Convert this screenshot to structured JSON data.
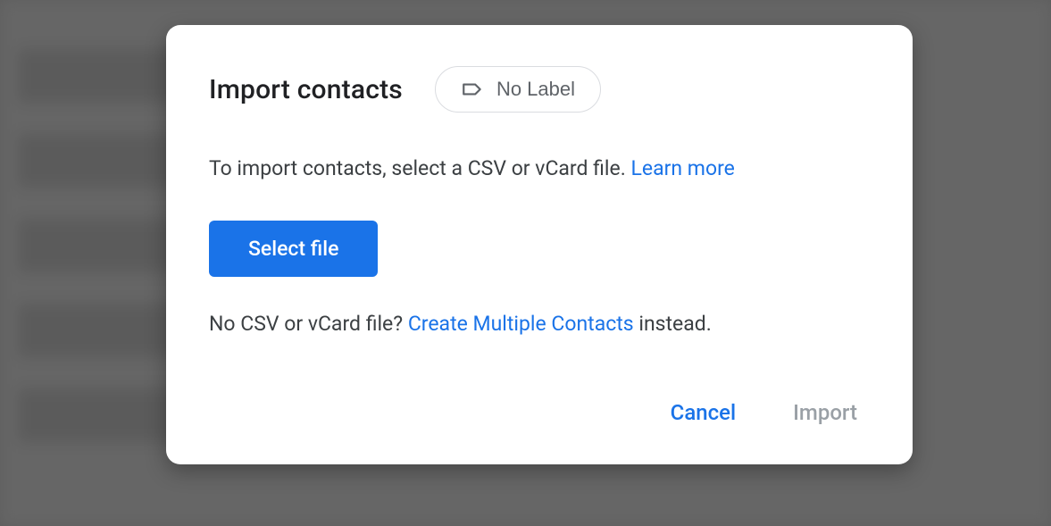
{
  "dialog": {
    "title": "Import contacts",
    "labelChip": {
      "text": "No Label"
    },
    "description": {
      "text": "To import contacts, select a CSV or vCard file. ",
      "learnMore": "Learn more"
    },
    "selectFileButton": "Select file",
    "secondary": {
      "prefix": "No CSV or vCard file? ",
      "link": "Create Multiple Contacts",
      "suffix": " instead."
    },
    "actions": {
      "cancel": "Cancel",
      "import": "Import"
    }
  }
}
